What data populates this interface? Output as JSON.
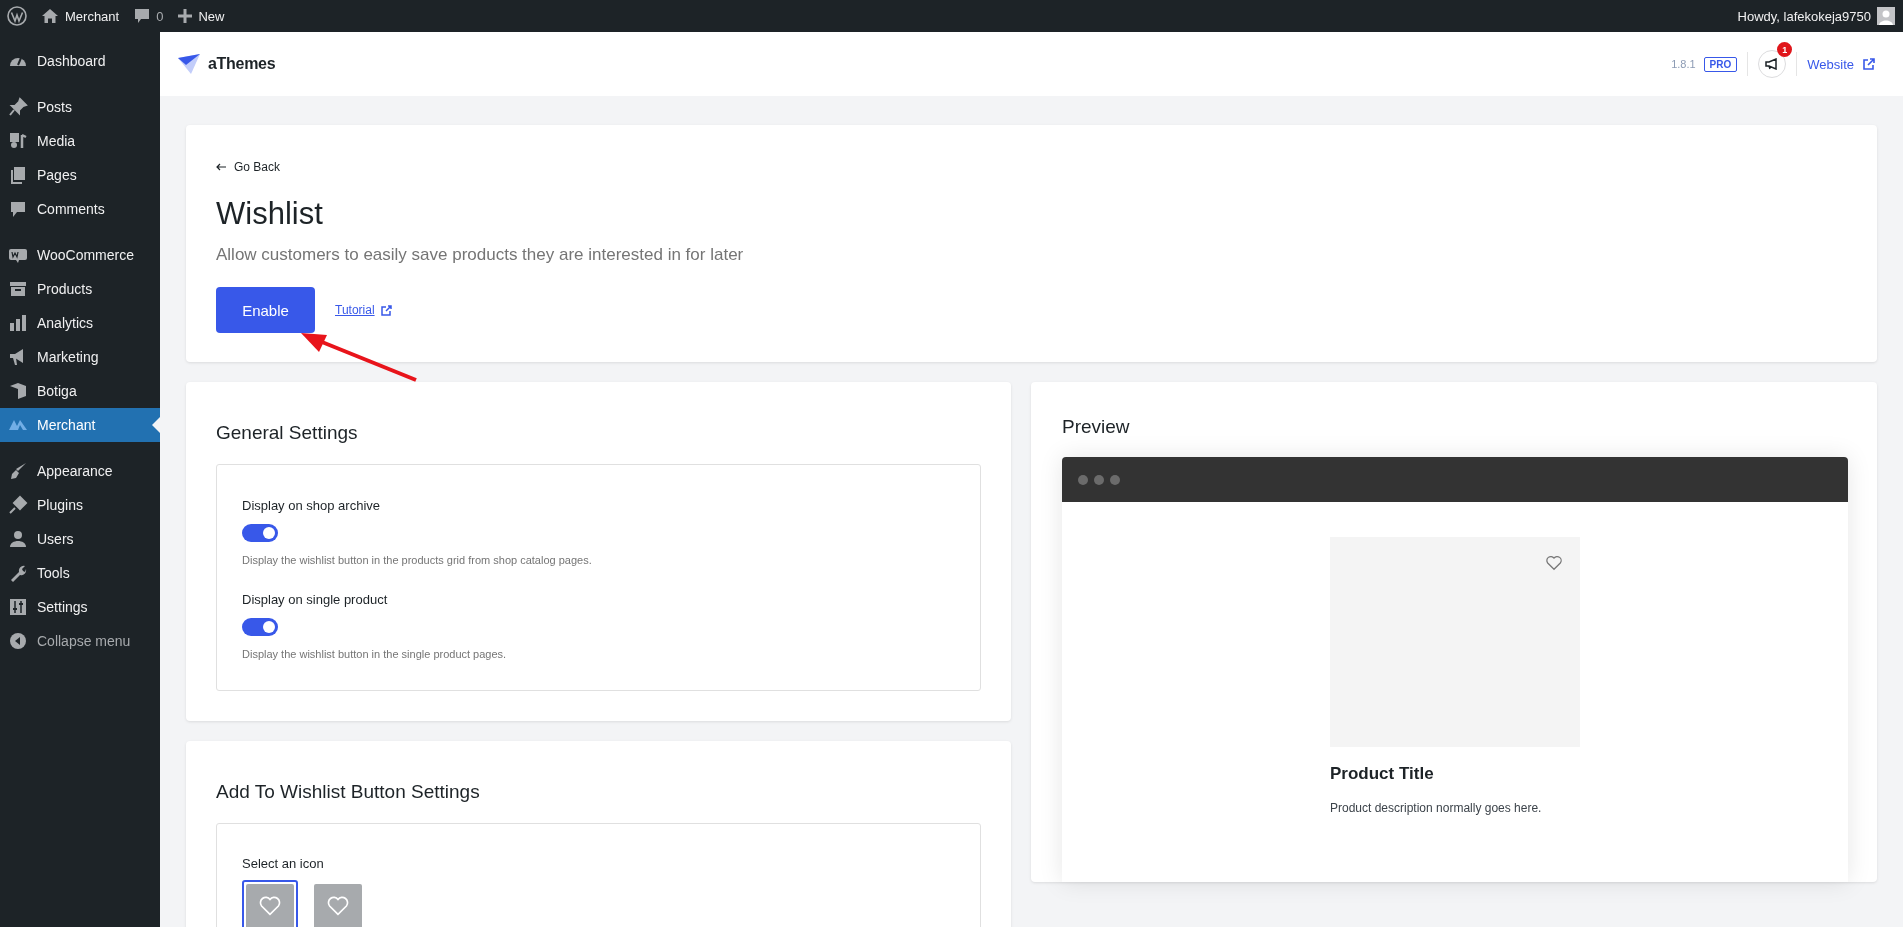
{
  "admin_bar": {
    "site": "Merchant",
    "comments": "0",
    "new": "New",
    "greeting": "Howdy, lafekokeja9750"
  },
  "sidebar": {
    "groups": [
      [
        {
          "label": "Dashboard",
          "selected": false
        }
      ],
      [
        {
          "label": "Posts",
          "selected": false
        },
        {
          "label": "Media",
          "selected": false
        },
        {
          "label": "Pages",
          "selected": false
        },
        {
          "label": "Comments",
          "selected": false
        }
      ],
      [
        {
          "label": "WooCommerce",
          "selected": false
        },
        {
          "label": "Products",
          "selected": false
        },
        {
          "label": "Analytics",
          "selected": false
        },
        {
          "label": "Marketing",
          "selected": false
        },
        {
          "label": "Botiga",
          "selected": false
        },
        {
          "label": "Merchant",
          "selected": true
        }
      ],
      [
        {
          "label": "Appearance",
          "selected": false
        },
        {
          "label": "Plugins",
          "selected": false
        },
        {
          "label": "Users",
          "selected": false
        },
        {
          "label": "Tools",
          "selected": false
        },
        {
          "label": "Settings",
          "selected": false
        }
      ]
    ],
    "collapse": "Collapse menu"
  },
  "header": {
    "logo": "aThemes",
    "version": "1.8.1",
    "badge": "PRO",
    "notifications": "1",
    "website_link": "Website"
  },
  "intro": {
    "back": "Go Back",
    "title": "Wishlist",
    "description": "Allow customers to easily save products they are interested in for later",
    "enable_button": "Enable",
    "tutorial_link": "Tutorial"
  },
  "general_settings": {
    "title": "General Settings",
    "options": [
      {
        "label": "Display on shop archive",
        "on": true,
        "help": "Display the wishlist button in the products grid from shop catalog pages."
      },
      {
        "label": "Display on single product",
        "on": true,
        "help": "Display the wishlist button in the single product pages."
      }
    ]
  },
  "button_settings": {
    "title": "Add To Wishlist Button Settings",
    "select_label": "Select an icon",
    "icons": [
      {
        "selected": true
      },
      {
        "selected": false
      }
    ]
  },
  "preview": {
    "title": "Preview",
    "product_title": "Product Title",
    "product_description": "Product description normally goes here."
  }
}
